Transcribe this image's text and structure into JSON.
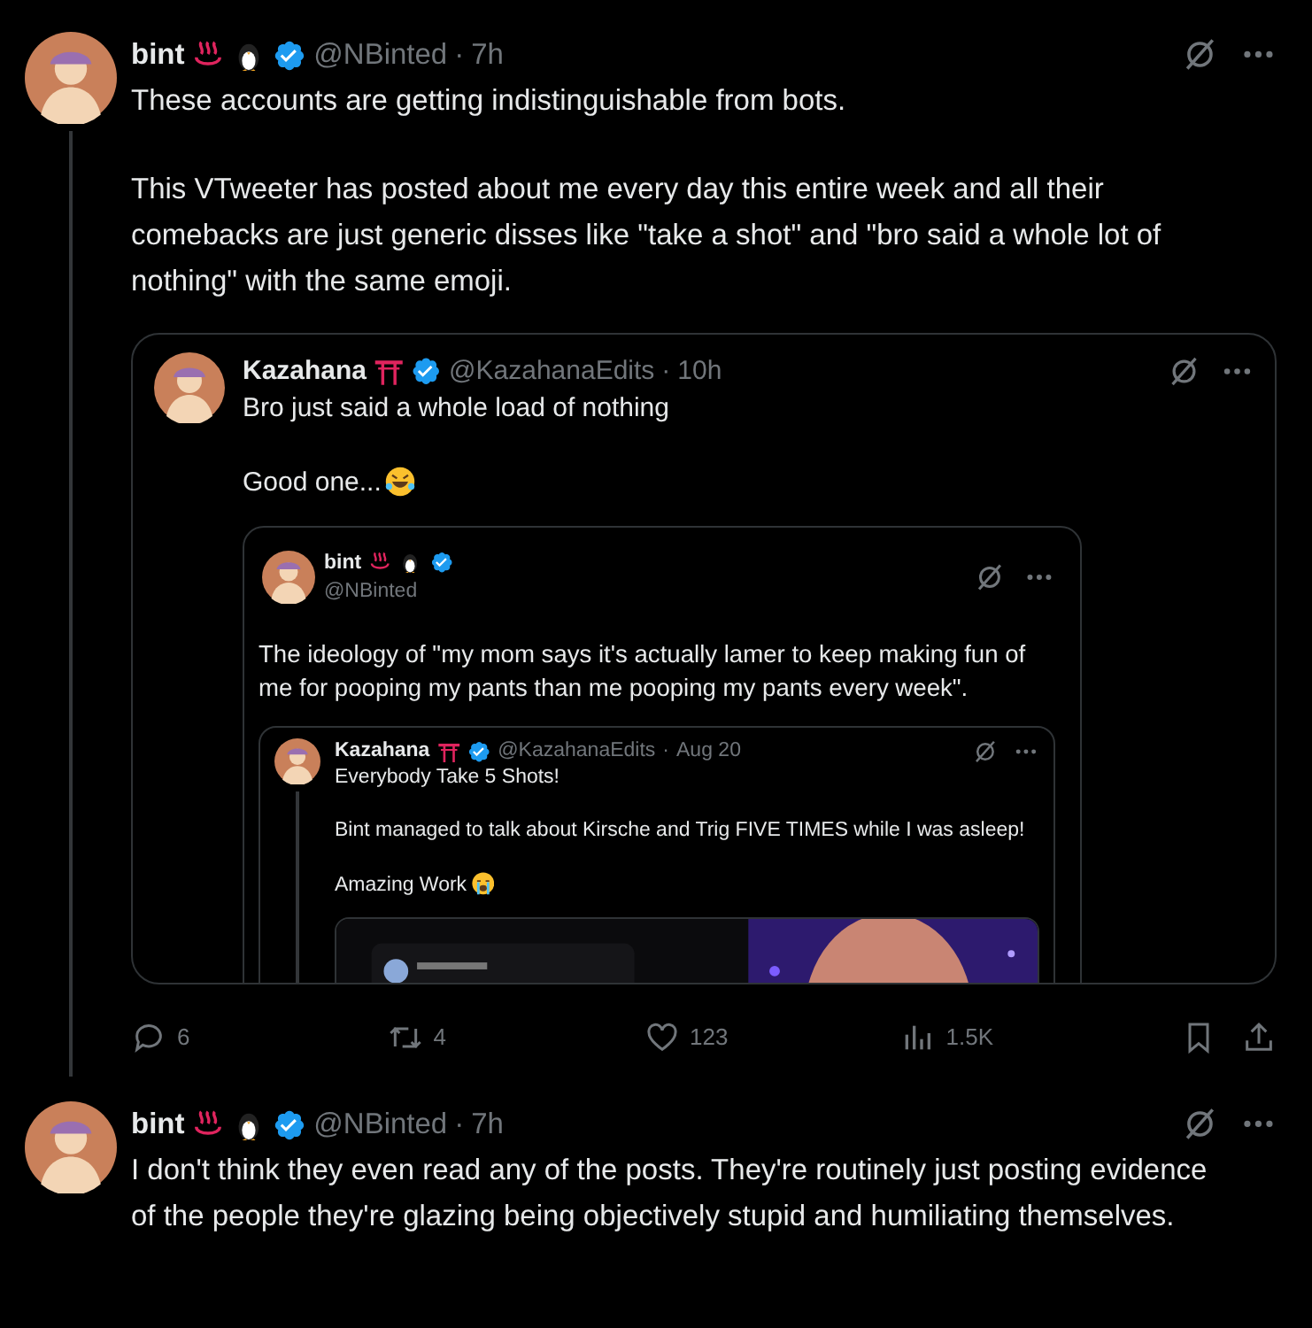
{
  "posts": [
    {
      "author": {
        "name": "bint",
        "badges": [
          {
            "kind": "hot-springs"
          },
          {
            "kind": "penguin"
          }
        ],
        "verified": true,
        "handle": "@NBinted",
        "separator": "·",
        "time": "7h"
      },
      "kind": "inline",
      "thread_line": true,
      "paragraphs": [
        {
          "text": "These accounts are getting indistinguishable from bots."
        },
        {
          "text": "This VTweeter has posted about me every day this entire week and all their comebacks are just generic disses like \"take a shot\" and \"bro said a whole lot of nothing\" with the same emoji."
        }
      ],
      "quote": {
        "author": {
          "name": "Kazahana",
          "badges": [
            {
              "kind": "torii"
            }
          ],
          "verified": true,
          "handle": "@KazahanaEdits",
          "separator": "·",
          "time": "10h"
        },
        "kind": "inline",
        "thread_line": false,
        "paragraphs": [
          {
            "text": "Bro just said a whole load of nothing"
          },
          {
            "text": "Good one...",
            "emoji": {
              "kind": "laughing"
            }
          }
        ],
        "quote": {
          "author": {
            "name": "bint",
            "badges": [
              {
                "kind": "hot-springs"
              },
              {
                "kind": "penguin"
              }
            ],
            "verified": true,
            "handle": "@NBinted"
          },
          "kind": "stacked",
          "thread_line": false,
          "paragraphs": [
            {
              "text": "The ideology of \"my mom says it's actually lamer to keep making fun of me for pooping my pants than me pooping my pants every week\"."
            }
          ],
          "quote": {
            "author": {
              "name": "Kazahana",
              "badges": [
                {
                  "kind": "torii"
                }
              ],
              "verified": true,
              "handle": "@KazahanaEdits",
              "separator": "·",
              "time": "Aug 20"
            },
            "kind": "inline",
            "thread_line": true,
            "paragraphs": [
              {
                "text": "Everybody Take 5 Shots!"
              },
              {
                "text": "Bint managed to talk about Kirsche and Trig FIVE TIMES while I was asleep!"
              },
              {
                "text": "Amazing Work",
                "emoji": {
                  "kind": "crying"
                }
              }
            ]
          }
        }
      },
      "actions": [
        {
          "kind": "reply",
          "count": "6"
        },
        {
          "kind": "repost",
          "count": "4"
        },
        {
          "kind": "like",
          "count": "123"
        },
        {
          "kind": "views",
          "count": "1.5K"
        },
        {
          "kind": "bookmark"
        },
        {
          "kind": "share"
        }
      ]
    },
    {
      "author": {
        "name": "bint",
        "badges": [
          {
            "kind": "hot-springs"
          },
          {
            "kind": "penguin"
          }
        ],
        "verified": true,
        "handle": "@NBinted",
        "separator": "·",
        "time": "7h"
      },
      "kind": "inline",
      "thread_line": false,
      "paragraphs": [
        {
          "text": "I don't think they even read any of the posts. They're routinely just posting evidence of the people they're glazing being objectively stupid and humiliating themselves."
        }
      ]
    }
  ]
}
